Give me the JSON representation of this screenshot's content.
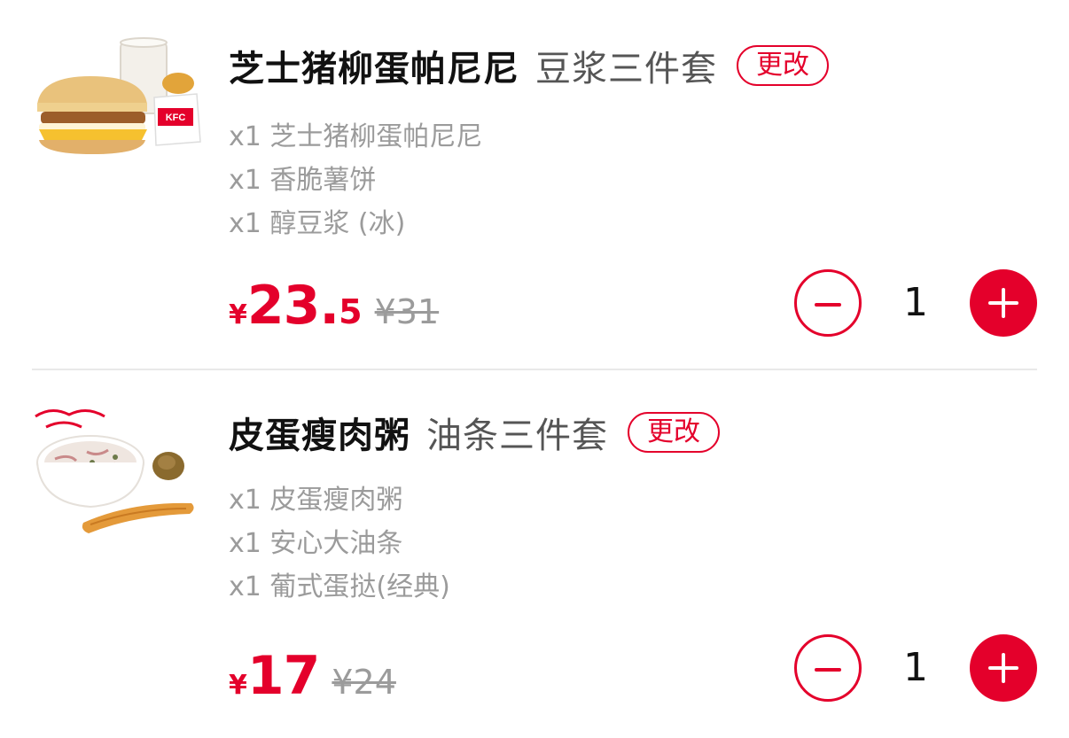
{
  "cart": {
    "items": [
      {
        "name": "芝士猪柳蛋帕尼尼",
        "subtitle": "豆浆三件套",
        "change_label": "更改",
        "components": [
          "x1 芝士猪柳蛋帕尼尼",
          "x1 香脆薯饼",
          "x1 醇豆浆 (冰)"
        ],
        "price_symbol": "¥",
        "price_integer": "23.",
        "price_decimal": "5",
        "original_price": "¥31",
        "quantity": "1",
        "image_icon": "breakfast-panini-set-image",
        "image_text": "KFC"
      },
      {
        "name": "皮蛋瘦肉粥",
        "subtitle": "油条三件套",
        "change_label": "更改",
        "components": [
          "x1 皮蛋瘦肉粥",
          "x1 安心大油条",
          "x1 葡式蛋挞(经典)"
        ],
        "price_symbol": "¥",
        "price_integer": "17",
        "price_decimal": "",
        "original_price": "¥24",
        "quantity": "1",
        "image_icon": "congee-youtiao-set-image"
      }
    ]
  },
  "colors": {
    "accent": "#e4002b",
    "title": "#111111",
    "subtitle": "#555555",
    "muted": "#9b9b9b",
    "divider": "#e9e9e9"
  },
  "icons": {
    "minus": "minus-circle-icon",
    "plus": "plus-circle-icon"
  }
}
